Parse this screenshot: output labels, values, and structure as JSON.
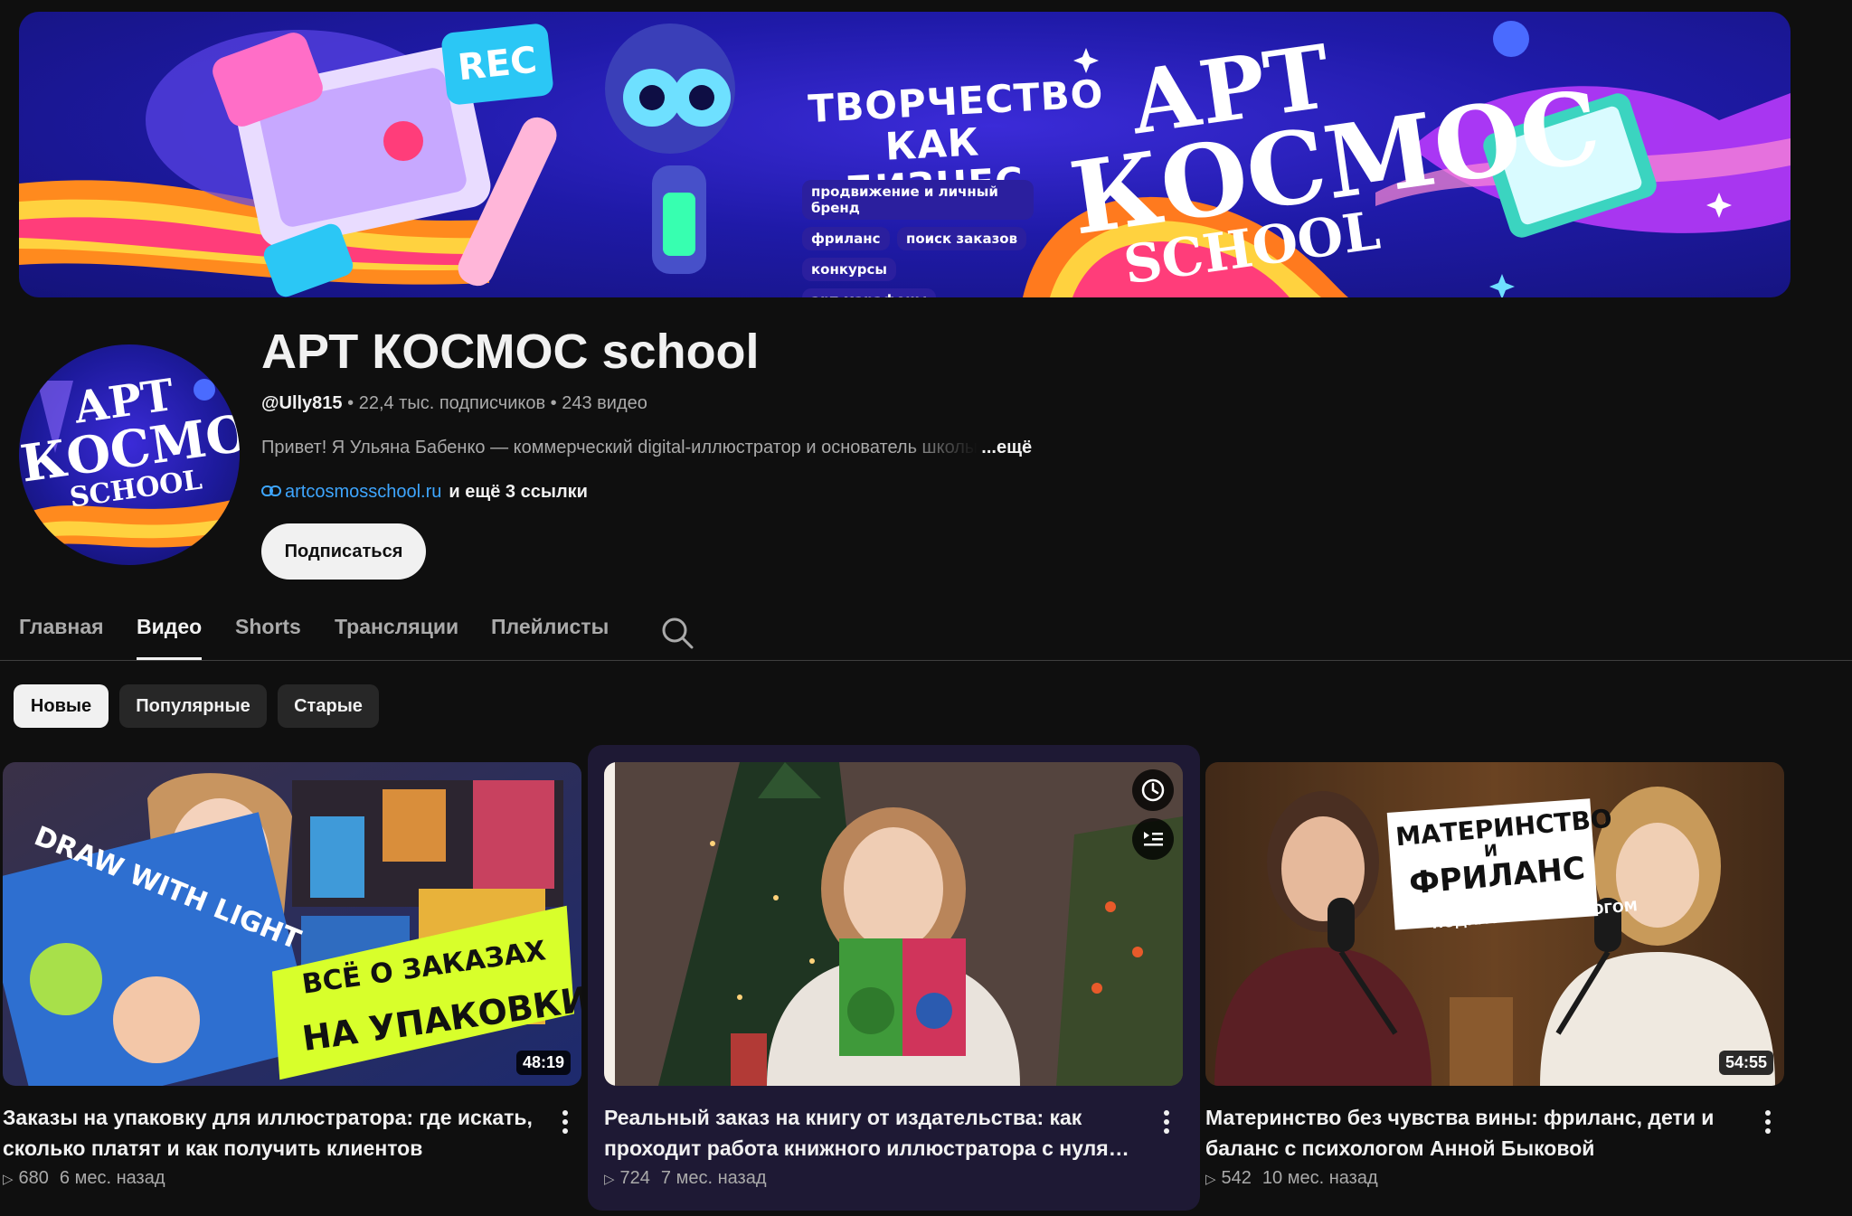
{
  "banner": {
    "rec_label": "REC",
    "tagline": "ТВОРЧЕСТВО КАК БИЗНЕС",
    "tags": [
      "продвижение и личный бренд",
      "фриланс",
      "поиск заказов",
      "конкурсы",
      "арт-марафоны"
    ],
    "logo_line1": "АРТ",
    "logo_line2": "КОСМОС",
    "logo_line3": "SCHOOL"
  },
  "avatar": {
    "line1": "АРТ",
    "line2": "КОСМОС",
    "line3": "SCHOOL"
  },
  "channel": {
    "name": "АРТ КОСМОС school",
    "handle": "@Ully815",
    "subscribers": "22,4 тыс. подписчиков",
    "videos": "243 видео",
    "separator": "•",
    "description": "Привет! Я Ульяна Бабенко — коммерческий digital-иллюстратор и основатель школы",
    "more_label": "...ещё",
    "link": "artcosmosschool.ru",
    "more_links": "и ещё 3 ссылки",
    "subscribe_label": "Подписаться"
  },
  "tabs": [
    {
      "label": "Главная",
      "active": false
    },
    {
      "label": "Видео",
      "active": true
    },
    {
      "label": "Shorts",
      "active": false
    },
    {
      "label": "Трансляции",
      "active": false
    },
    {
      "label": "Плейлисты",
      "active": false
    }
  ],
  "chips": [
    {
      "label": "Новые",
      "active": true
    },
    {
      "label": "Популярные",
      "active": false
    },
    {
      "label": "Старые",
      "active": false
    }
  ],
  "videos": [
    {
      "title": "Заказы на упаковку для иллюстратора: где искать, сколько платят и как получить клиентов",
      "views": "680",
      "ago": "6 мес. назад",
      "duration": "48:19",
      "thumb_book": "DRAW WITH LIGHT",
      "thumb_line1": "ВСЁ О ЗАКАЗАХ",
      "thumb_line2": "НА УПАКОВКИ"
    },
    {
      "title": "Реальный заказ на книгу от издательства: как проходит работа книжного иллюстратора с нуля до результата",
      "views": "724",
      "ago": "7 мес. назад",
      "duration": "",
      "hovered": true
    },
    {
      "title": "Материнство без чувства вины: фриланс, дети и баланс с психологом Анной Быковой",
      "views": "542",
      "ago": "10 мес. назад",
      "duration": "54:55",
      "thumb_line1": "МАТЕРИНСТВО",
      "thumb_line2": "И",
      "thumb_line3": "ФРИЛАНС",
      "thumb_line4": "ПОДКАСТ С ПСИХОЛОГОМ"
    }
  ],
  "colors": {
    "background": "#0f0f0f",
    "link": "#3ea6ff",
    "hover_card": "#1e1934"
  }
}
